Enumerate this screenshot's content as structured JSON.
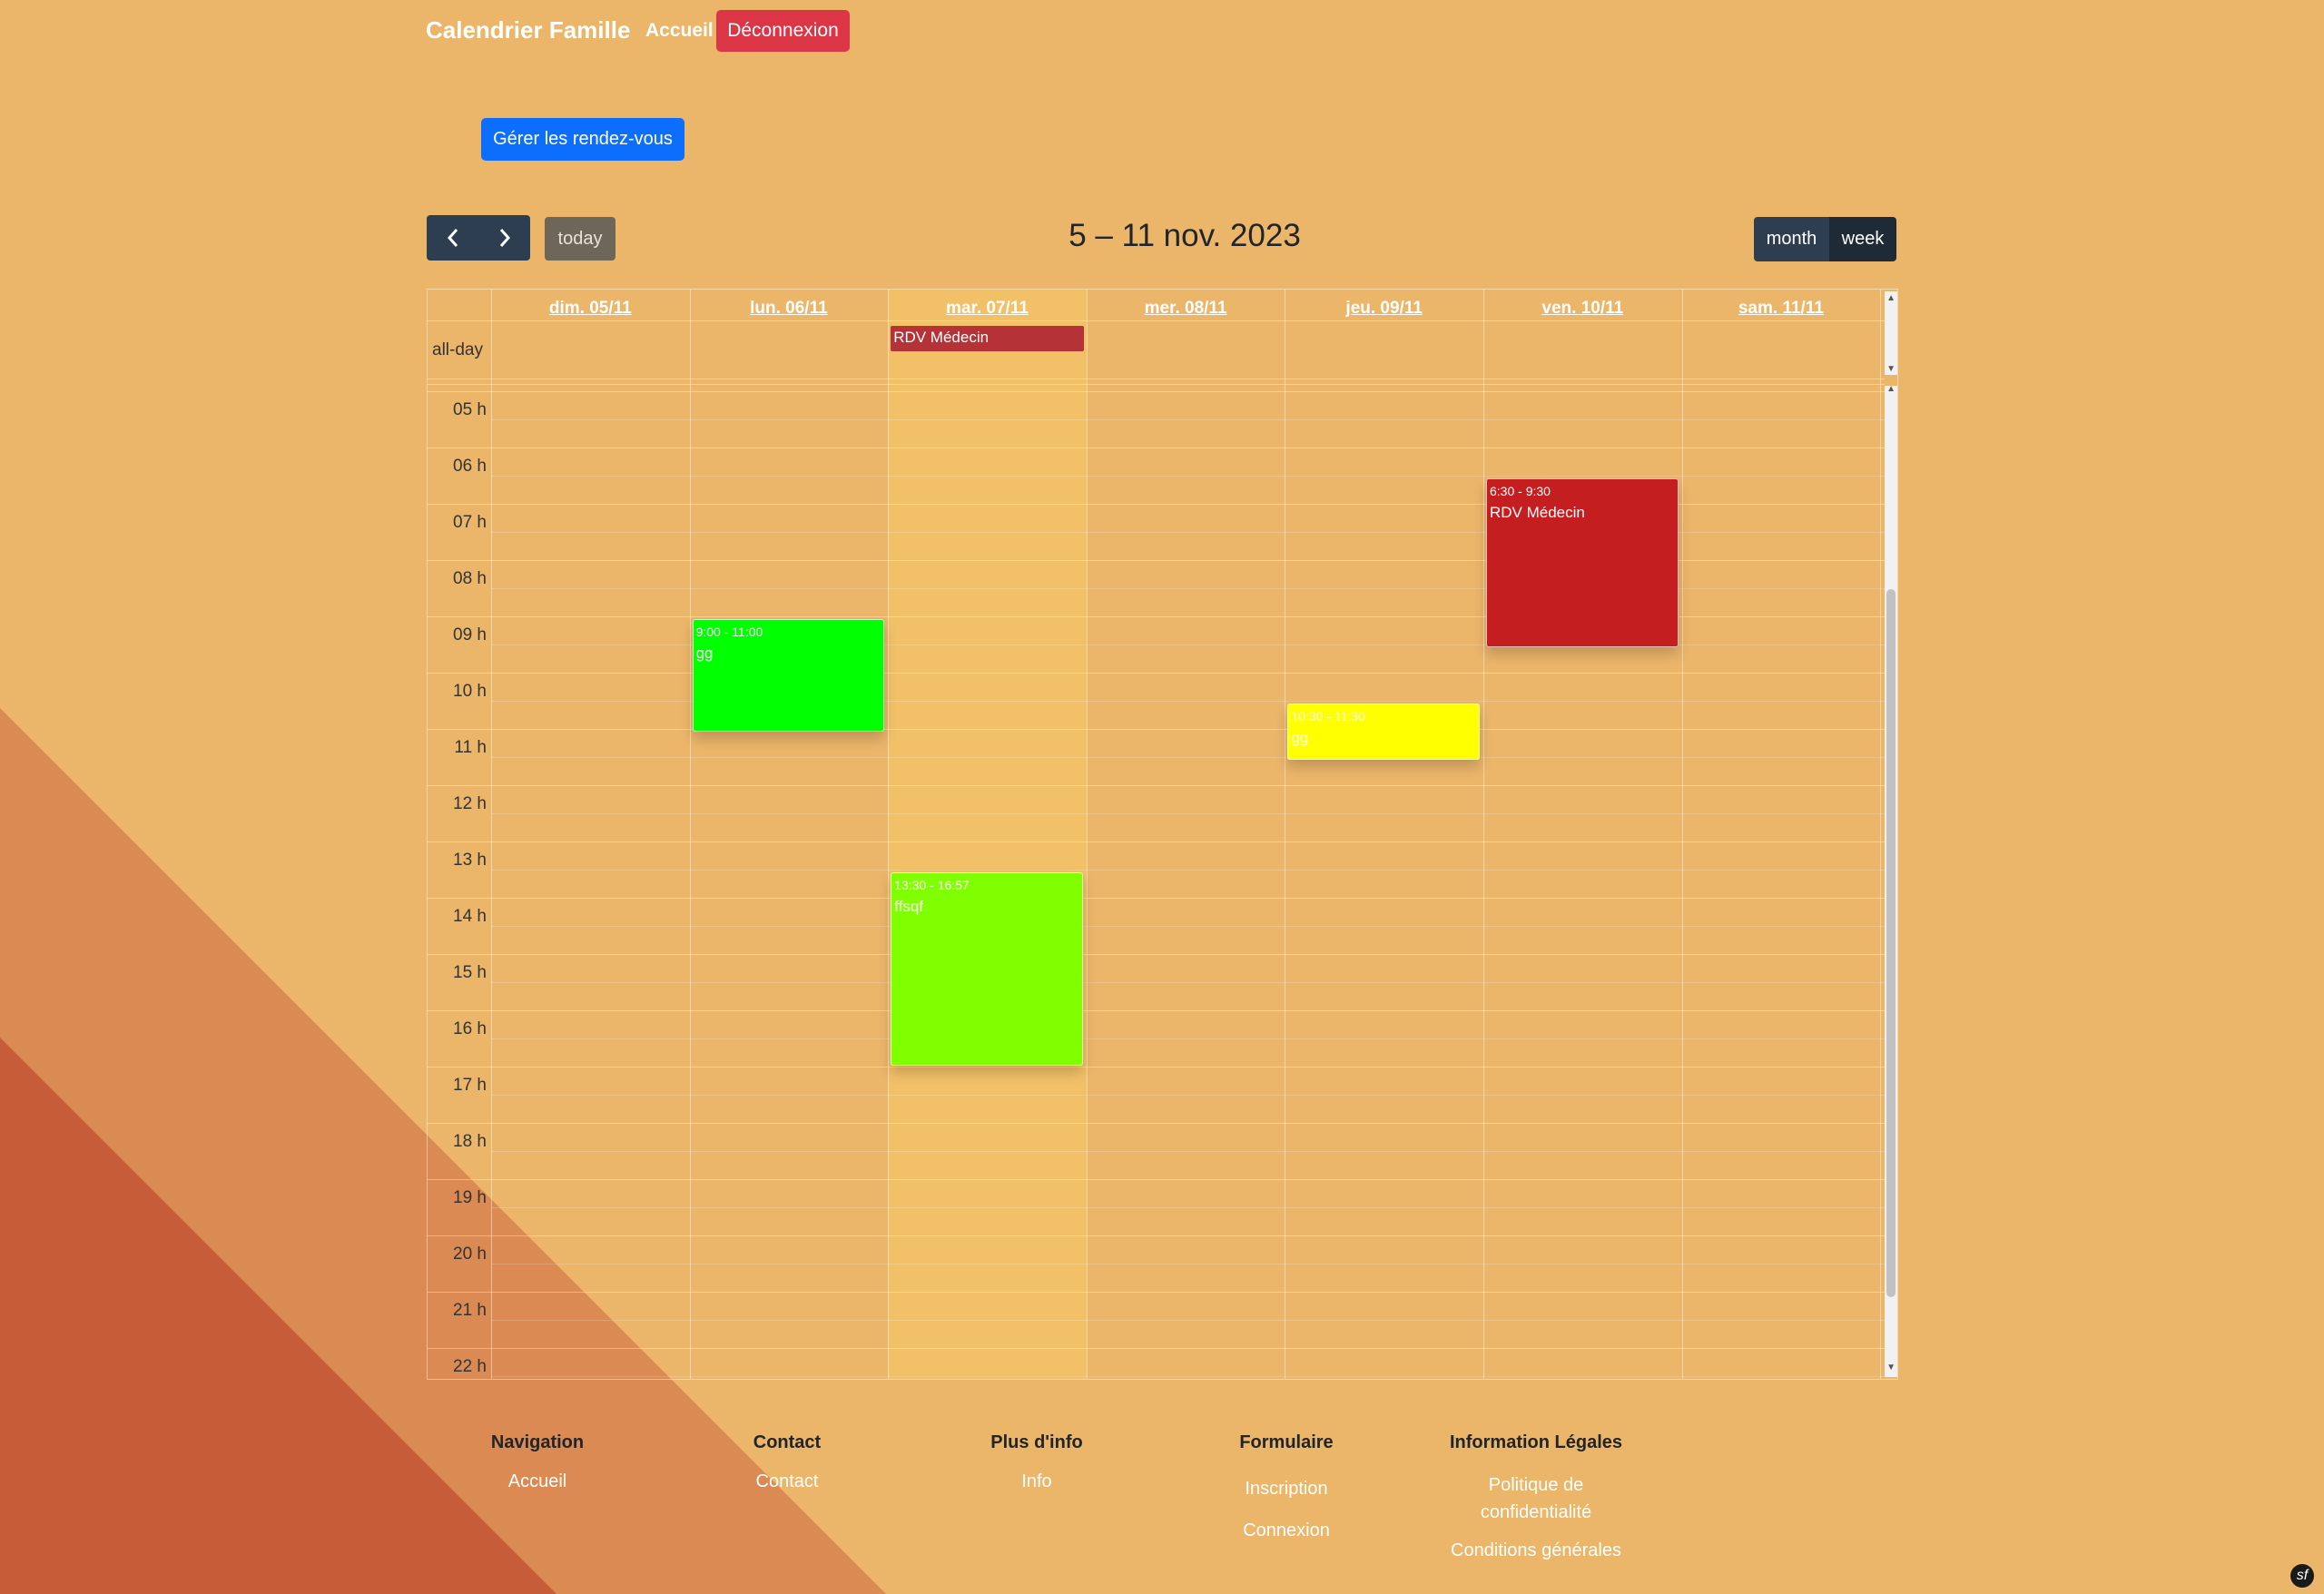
{
  "navbar": {
    "brand": "Calendrier Famille",
    "home": "Accueil",
    "logout": "Déconnexion"
  },
  "actions": {
    "manage": "Gérer les rendez-vous"
  },
  "toolbar": {
    "prev_icon": "chevron-left-icon",
    "next_icon": "chevron-right-icon",
    "today": "today",
    "title": "5 – 11 nov. 2023",
    "month": "month",
    "week": "week"
  },
  "calendar": {
    "days": [
      "dim. 05/11",
      "lun. 06/11",
      "mar. 07/11",
      "mer. 08/11",
      "jeu. 09/11",
      "ven. 10/11",
      "sam. 11/11"
    ],
    "today_index": 2,
    "allday_label": "all-day",
    "hours": [
      "05 h",
      "06 h",
      "07 h",
      "08 h",
      "09 h",
      "10 h",
      "11 h",
      "12 h",
      "13 h",
      "14 h",
      "15 h",
      "16 h",
      "17 h",
      "18 h",
      "19 h",
      "20 h",
      "21 h",
      "22 h"
    ],
    "allday_events": [
      {
        "day": 2,
        "title": "RDV Médecin",
        "color": "#b53236"
      }
    ],
    "events": [
      {
        "day": 1,
        "start": 9.0,
        "end": 11.0,
        "time": "9:00 - 11:00",
        "title": "gg",
        "color": "#00ff00"
      },
      {
        "day": 2,
        "start": 13.5,
        "end": 16.95,
        "time": "13:30 - 16:57",
        "title": "ffsqf",
        "color": "#80ff00"
      },
      {
        "day": 4,
        "start": 10.5,
        "end": 11.5,
        "time": "10:30 - 11:30",
        "title": "gg",
        "color": "#ffff00"
      },
      {
        "day": 5,
        "start": 6.5,
        "end": 9.5,
        "time": "6:30 - 9:30",
        "title": "RDV Médecin",
        "color": "#c41e20"
      }
    ]
  },
  "footer": {
    "navigation": {
      "title": "Navigation",
      "links": [
        "Accueil"
      ]
    },
    "contact": {
      "title": "Contact",
      "links": [
        "Contact"
      ]
    },
    "info": {
      "title": "Plus d'info",
      "links": [
        "Info"
      ]
    },
    "form": {
      "title": "Formulaire",
      "links": [
        "Inscription",
        "Connexion"
      ]
    },
    "legal": {
      "title": "Information Légales",
      "links": [
        "Politique de confidentialité",
        "Conditions générales"
      ]
    }
  },
  "colors": {
    "background": "#ebb56a",
    "stripe1": "#da8a52",
    "stripe2": "#c65d38",
    "primary": "#0d6efd",
    "danger": "#dc3545"
  }
}
